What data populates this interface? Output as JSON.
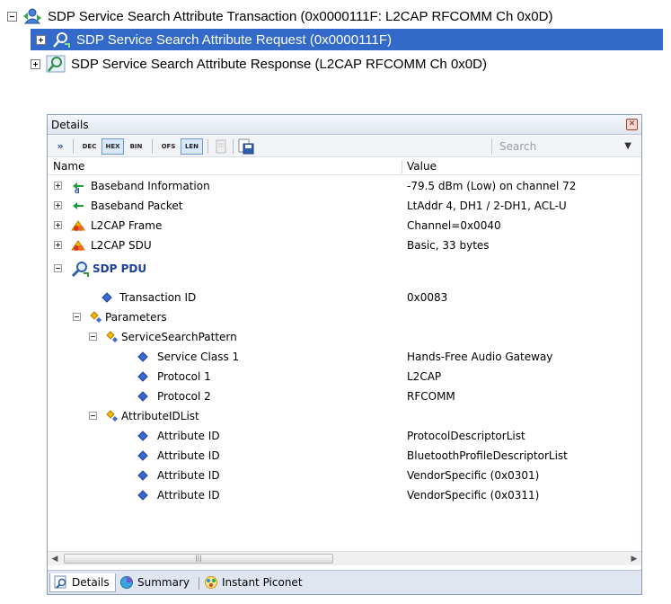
{
  "top_tree": {
    "rows": [
      {
        "label": "SDP Service Search Attribute Transaction (0x0000111F: L2CAP RFCOMM Ch 0x0D)",
        "expanded": true,
        "selected": false
      },
      {
        "label": "SDP Service Search Attribute Request (0x0000111F)",
        "expanded": false,
        "selected": true
      },
      {
        "label": "SDP Service Search Attribute Response (L2CAP RFCOMM Ch 0x0D)",
        "expanded": false,
        "selected": false
      }
    ]
  },
  "details": {
    "title": "Details",
    "toolbar": {
      "buttons": [
        {
          "label": "DEC",
          "active": false
        },
        {
          "label": "HEX",
          "active": true
        },
        {
          "label": "BIN",
          "active": false
        },
        {
          "label": "OFS",
          "active": false
        },
        {
          "label": "LEN",
          "active": true
        }
      ],
      "search_placeholder": "Search"
    },
    "columns": {
      "name": "Name",
      "value": "Value"
    },
    "rows": [
      {
        "name": "Baseband Information",
        "value": "-79.5 dBm (Low) on channel 72",
        "icon": "baseband-info-icon"
      },
      {
        "name": "Baseband Packet",
        "value": "LtAddr 4, DH1 / 2-DH1, ACL-U",
        "icon": "arrow-left-icon"
      },
      {
        "name": "L2CAP Frame",
        "value": "Channel=0x0040",
        "icon": "l2cap-icon"
      },
      {
        "name": "L2CAP SDU",
        "value": "Basic, 33 bytes",
        "icon": "l2cap-icon"
      },
      {
        "name": "SDP PDU",
        "value": "",
        "icon": "sdp-search-icon"
      },
      {
        "name": "Transaction ID",
        "value": "0x0083",
        "icon": "field-diamond-icon"
      },
      {
        "name": "Parameters",
        "value": "",
        "icon": "parameters-icon"
      },
      {
        "name": "ServiceSearchPattern",
        "value": "",
        "icon": "parameters-icon"
      },
      {
        "name": "Service Class 1",
        "value": "Hands-Free Audio Gateway",
        "icon": "field-diamond-icon"
      },
      {
        "name": "Protocol 1",
        "value": "L2CAP",
        "icon": "field-diamond-icon"
      },
      {
        "name": "Protocol 2",
        "value": "RFCOMM",
        "icon": "field-diamond-icon"
      },
      {
        "name": "AttributeIDList",
        "value": "",
        "icon": "parameters-icon"
      },
      {
        "name": "Attribute ID",
        "value": "ProtocolDescriptorList",
        "icon": "field-diamond-icon"
      },
      {
        "name": "Attribute ID",
        "value": "BluetoothProfileDescriptorList",
        "icon": "field-diamond-icon"
      },
      {
        "name": "Attribute ID",
        "value": "VendorSpecific (0x0301)",
        "icon": "field-diamond-icon"
      },
      {
        "name": "Attribute ID",
        "value": "VendorSpecific (0x0311)",
        "icon": "field-diamond-icon"
      }
    ],
    "tabs": [
      {
        "label": "Details",
        "active": true
      },
      {
        "label": "Summary",
        "active": false
      },
      {
        "label": "Instant Piconet",
        "active": false
      }
    ]
  },
  "colors": {
    "selection": "#3369c9",
    "sdp_pdu_text": "#1f3f9c",
    "diamond_icon": "#3a6ad1"
  }
}
